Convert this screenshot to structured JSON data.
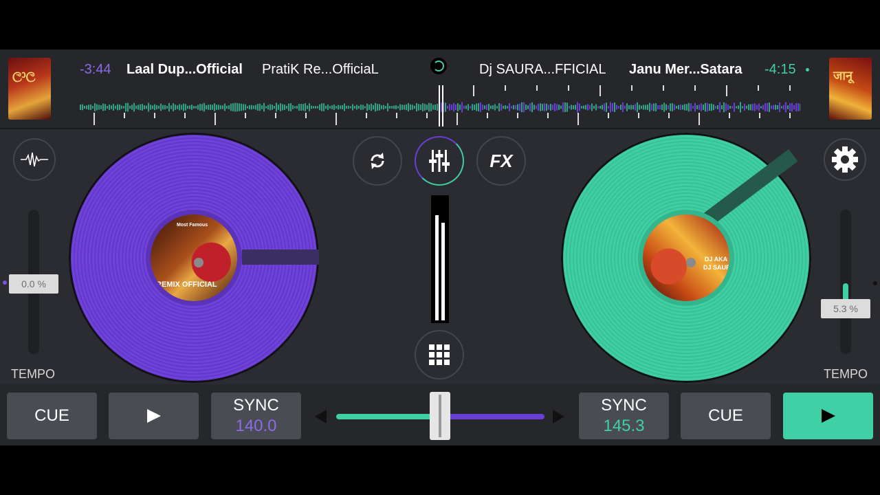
{
  "colors": {
    "deck_left": "#6f42d8",
    "deck_right": "#3fcfa3",
    "background": "#2b2c31",
    "play_active": "#3fd0a6"
  },
  "icons": {
    "waveform": "waveform-icon",
    "loop": "loop-icon",
    "mixer": "mixer-sliders-icon",
    "settings": "gear-icon",
    "pads": "grid-icon",
    "play": "play-icon"
  },
  "deck_left": {
    "remaining_time": "-3:44",
    "title": "Laal Dup...Official",
    "artist": "PratiK Re...OfficiaL",
    "label_text": "REMIX OFFICIAL",
    "label_top_text": "Most Famous",
    "tempo_value": "0.0 %",
    "tempo_label": "TEMPO",
    "cue_label": "CUE",
    "sync_label": "SYNC",
    "bpm": "140.0",
    "playing": false
  },
  "deck_right": {
    "remaining_time": "-4:15",
    "title": "Janu Mer...Satara",
    "artist": "Dj SAURA...FFICIAL",
    "label_text": "DJ AKA",
    "label_text2": "DJ SAUR",
    "tempo_value": "5.3 %",
    "tempo_label": "TEMPO",
    "cue_label": "CUE",
    "sync_label": "SYNC",
    "bpm": "145.3",
    "playing": true
  },
  "center": {
    "fx_label": "FX",
    "crossfader_position": 0.5,
    "vu_left_level": 0.86,
    "vu_right_level": 0.8
  }
}
